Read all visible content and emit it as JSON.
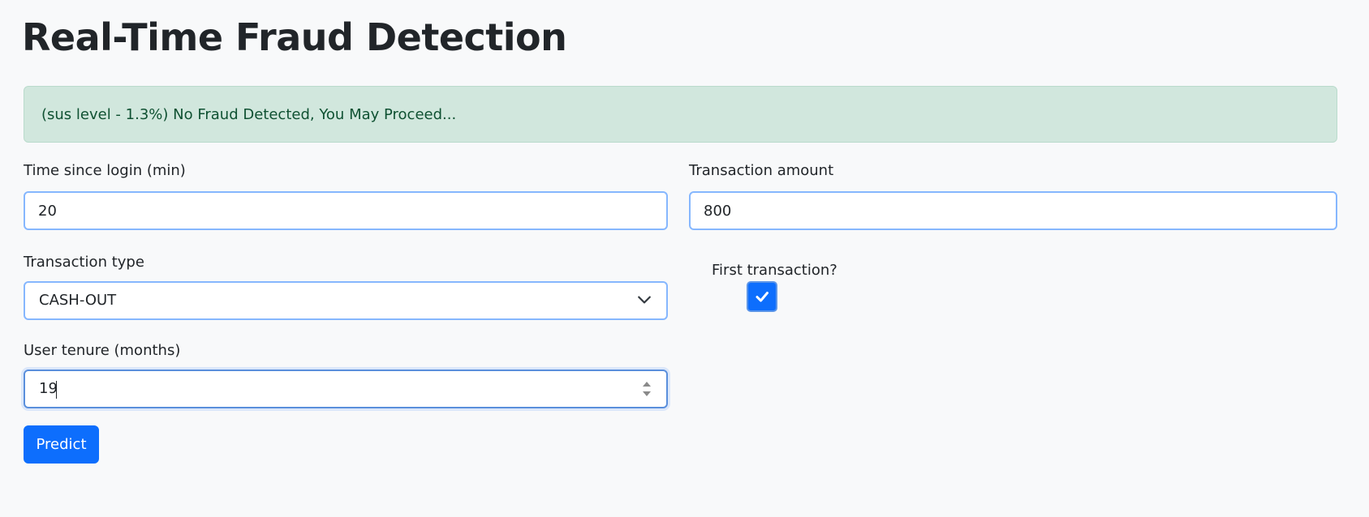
{
  "page": {
    "title": "Real-Time Fraud Detection"
  },
  "alert": {
    "message": "(sus level - 1.3%) No Fraud Detected, You May Proceed...",
    "status": "success",
    "background_color": "#d1e7dd",
    "text_color": "#0f5132"
  },
  "form": {
    "time_since_login": {
      "label": "Time since login (min)",
      "value": "20"
    },
    "transaction_amount": {
      "label": "Transaction amount",
      "value": "800"
    },
    "transaction_type": {
      "label": "Transaction type",
      "selected": "CASH-OUT",
      "icon": "chevron-down-icon"
    },
    "first_transaction": {
      "label": "First transaction?",
      "checked": true,
      "icon": "checkmark-icon"
    },
    "user_tenure": {
      "label": "User tenure (months)",
      "value": "19",
      "icon": "number-stepper-icon"
    },
    "predict_button": {
      "label": "Predict"
    }
  },
  "colors": {
    "page_background": "#f8f9fa",
    "primary": "#0d6efd",
    "input_focus_border": "#86b7fe"
  }
}
